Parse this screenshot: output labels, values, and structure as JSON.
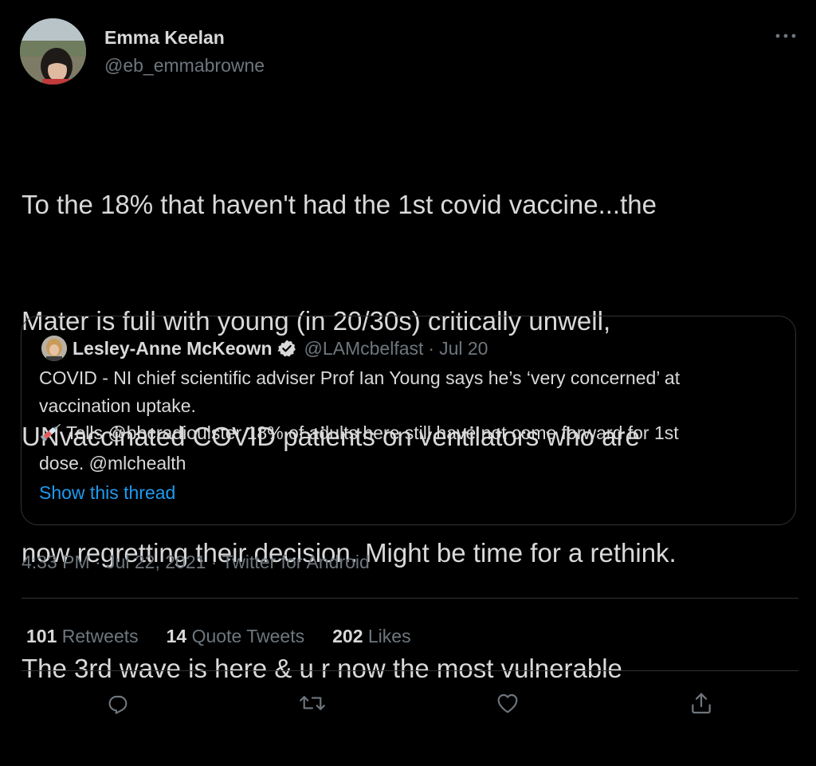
{
  "author": {
    "name": "Emma Keelan",
    "handle": "@eb_emmabrowne"
  },
  "tweet": {
    "lines": [
      "To the 18% that haven't had the 1st covid vaccine...the",
      "Mater is full with young (in 20/30s) critically unwell,",
      "UNvaccinated COVID patients on ventilators who are",
      "now regretting their decision. Might be time for a rethink.",
      "The 3rd wave is here & u r now the most vulnerable"
    ]
  },
  "quoted_tweet": {
    "name": "Lesley-Anne McKeown",
    "handle": "@LAMcbelfast",
    "date": "Jul 20",
    "separator": "·",
    "line1": "COVID - NI chief scientific adviser Prof Ian Young says he’s ‘very concerned’ at",
    "line2": "vaccination uptake.",
    "line3": "Tells @bbcradioulster 18% of adults here still have not come forward for 1st",
    "line4": "dose. @mlchealth",
    "show_thread": "Show this thread"
  },
  "timestamp": "4:33 PM · Jul 22, 2021 · Twitter for Android",
  "stats": {
    "retweets_count": "101",
    "retweets_label": "Retweets",
    "quote_count": "14",
    "quote_label": "Quote Tweets",
    "likes_count": "202",
    "likes_label": "Likes"
  },
  "actions": [
    "reply-icon",
    "retweet-icon",
    "like-icon",
    "share-icon"
  ],
  "colors": {
    "background": "#000000",
    "text": "#d9d9d9",
    "secondary": "#6e767d",
    "link": "#1d9bf0",
    "border": "#2f3336"
  }
}
